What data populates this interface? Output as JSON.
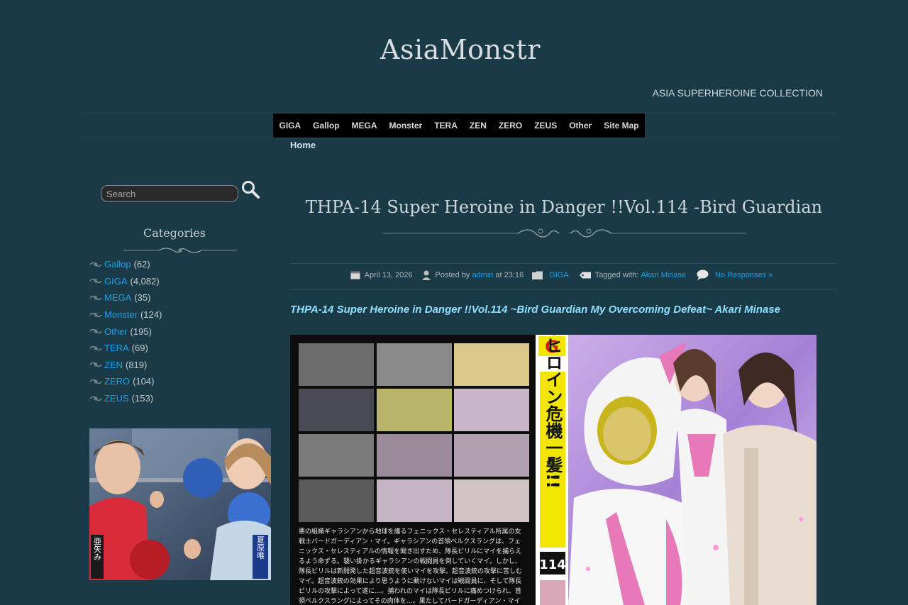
{
  "site": {
    "title": "AsiaMonstr",
    "tagline": "ASIA SUPERHEROINE COLLECTION"
  },
  "nav": {
    "items": [
      "GIGA",
      "Gallop",
      "MEGA",
      "Monster",
      "TERA",
      "ZEN",
      "ZERO",
      "ZEUS",
      "Other",
      "Site Map"
    ]
  },
  "breadcrumb": {
    "home": "Home"
  },
  "sidebar": {
    "search_placeholder": "Search",
    "categories_title": "Categories",
    "categories": [
      {
        "name": "Gallop",
        "count": "(62)"
      },
      {
        "name": "GIGA",
        "count": "(4,082)"
      },
      {
        "name": "MEGA",
        "count": "(35)"
      },
      {
        "name": "Monster",
        "count": "(124)"
      },
      {
        "name": "Other",
        "count": "(195)"
      },
      {
        "name": "TERA",
        "count": "(69)"
      },
      {
        "name": "ZEN",
        "count": "(819)"
      },
      {
        "name": "ZERO",
        "count": "(104)"
      },
      {
        "name": "ZEUS",
        "count": "(153)"
      }
    ]
  },
  "post": {
    "title": "THPA-14 Super Heroine in Danger !!Vol.114 -Bird Guardian",
    "date": "April 13, 2026",
    "posted_by_label": "Posted by",
    "author": "admin",
    "at_label": "at 23:16",
    "category": "GIGA",
    "tagged_label": "Tagged with:",
    "tag": "Akari Minase",
    "responses": "No Responses »",
    "subtitle": "THPA-14 Super Heroine in Danger !!Vol.114 ~Bird Guardian My Overcoming Defeat~ Akari Minase"
  },
  "cover": {
    "giga_badge": "G",
    "vertical_title": "スーパーヒロイン危機一髪!!",
    "volume": "114",
    "synopsis": [
      "悪の組織ギャラシアンから地球を護るフェニックス・セレスティアル所属の女",
      "戦士バードガーディアン・マイ。ギャラシアンの首領ベルクスラングは、フェ",
      "ニックス・セレスティアルの情報を聞き出すため、隊長ビリルにマイを捕らえ",
      "るよう命ずる。襲い掛かるギャラシアンの戦闘員を倒していくマイ。しかし、",
      "隊長ビリルは新開発した超音波銃を使いマイを攻撃。超音波銃の攻撃に苦しむ",
      "マイ。超音波銃の効果により思うように動けないマイは戦闘員に、そして隊長",
      "ビリルの攻撃によって遂に…。捕われのマイは隊長ビリルに痛めつけられ、首",
      "領ベルクスラングによってその肉体を…。果たしてバードガーディアン・マイ"
    ]
  },
  "ad": {
    "name_left": "亜矢み",
    "name_right": "夏原唯"
  },
  "colors": {
    "background": "#1b3a47",
    "link": "#1fa0e6",
    "subtitle": "#8fe0ff",
    "nav_bg": "#000000",
    "cover_pink": "#e879b8",
    "cover_yellow": "#f2e600"
  }
}
